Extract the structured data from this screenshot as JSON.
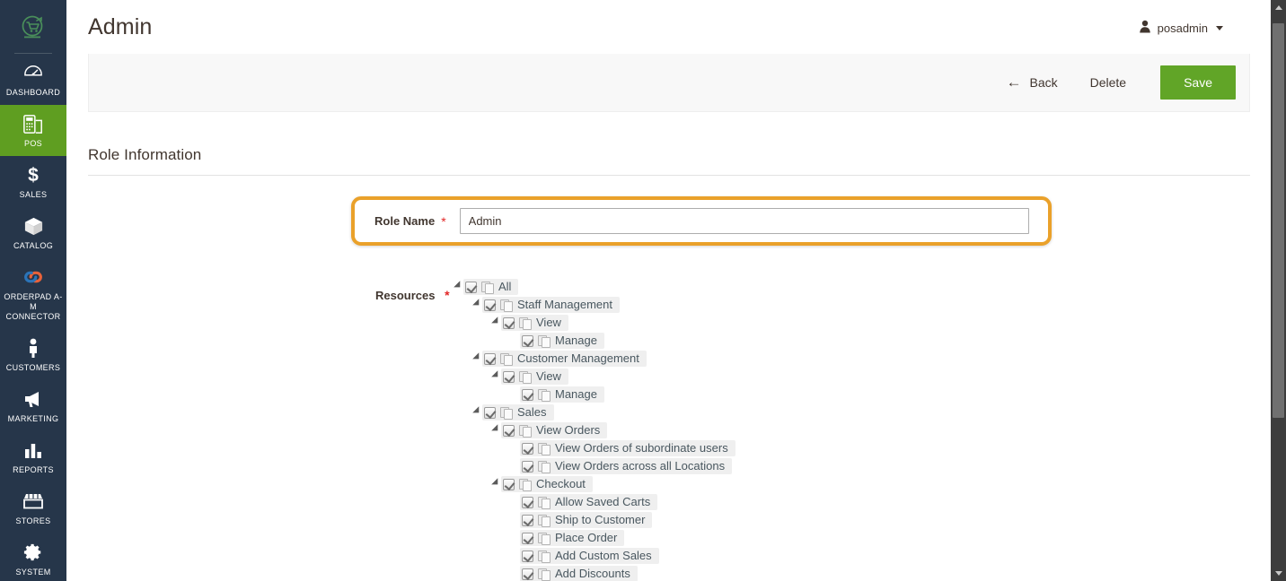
{
  "sidebar": {
    "logo_name": "pos-cart-logo",
    "items": [
      {
        "label": "DASHBOARD",
        "icon": "dashboard-gauge-icon",
        "active": false
      },
      {
        "label": "POS",
        "icon": "pos-terminal-icon",
        "active": true
      },
      {
        "label": "SALES",
        "icon": "dollar-sign-icon",
        "active": false
      },
      {
        "label": "CATALOG",
        "icon": "box-icon",
        "active": false
      },
      {
        "label": "ORDERPAD A-M\nCONNECTOR",
        "icon": "link-chain-icon",
        "active": false
      },
      {
        "label": "CUSTOMERS",
        "icon": "person-icon",
        "active": false
      },
      {
        "label": "MARKETING",
        "icon": "megaphone-icon",
        "active": false
      },
      {
        "label": "REPORTS",
        "icon": "bar-chart-icon",
        "active": false
      },
      {
        "label": "STORES",
        "icon": "storefront-icon",
        "active": false
      },
      {
        "label": "SYSTEM",
        "icon": "gear-icon",
        "active": false
      }
    ]
  },
  "header": {
    "title": "Admin",
    "account_name": "posadmin",
    "account_icon": "user-icon"
  },
  "toolbar": {
    "back_label": "Back",
    "back_icon": "arrow-left-icon",
    "delete_label": "Delete",
    "save_label": "Save",
    "save_color": "#61a527"
  },
  "section": {
    "title": "Role Information"
  },
  "form": {
    "role_name_label": "Role Name",
    "role_name_value": "Admin",
    "role_name_placeholder": "",
    "required_marker": "*",
    "highlight_color": "#eaa12a",
    "resources_label": "Resources"
  },
  "tree": [
    {
      "label": "All",
      "depth": 0,
      "checked": true,
      "expanded": true
    },
    {
      "label": "Staff Management",
      "depth": 1,
      "checked": true,
      "expanded": true
    },
    {
      "label": "View",
      "depth": 2,
      "checked": true,
      "expanded": true
    },
    {
      "label": "Manage",
      "depth": 3,
      "checked": true,
      "expanded": false
    },
    {
      "label": "Customer Management",
      "depth": 1,
      "checked": true,
      "expanded": true
    },
    {
      "label": "View",
      "depth": 2,
      "checked": true,
      "expanded": true
    },
    {
      "label": "Manage",
      "depth": 3,
      "checked": true,
      "expanded": false
    },
    {
      "label": "Sales",
      "depth": 1,
      "checked": true,
      "expanded": true
    },
    {
      "label": "View Orders",
      "depth": 2,
      "checked": true,
      "expanded": true
    },
    {
      "label": "View Orders of subordinate users",
      "depth": 3,
      "checked": true,
      "expanded": false
    },
    {
      "label": "View Orders across all Locations",
      "depth": 3,
      "checked": true,
      "expanded": false
    },
    {
      "label": "Checkout",
      "depth": 2,
      "checked": true,
      "expanded": true
    },
    {
      "label": "Allow Saved Carts",
      "depth": 3,
      "checked": true,
      "expanded": false
    },
    {
      "label": "Ship to Customer",
      "depth": 3,
      "checked": true,
      "expanded": false
    },
    {
      "label": "Place Order",
      "depth": 3,
      "checked": true,
      "expanded": false
    },
    {
      "label": "Add Custom Sales",
      "depth": 3,
      "checked": true,
      "expanded": false
    },
    {
      "label": "Add Discounts",
      "depth": 3,
      "checked": true,
      "expanded": false
    }
  ],
  "scrollbar": {
    "up_icon": "scroll-up-arrow-icon",
    "down_icon": "scroll-down-arrow-icon"
  }
}
